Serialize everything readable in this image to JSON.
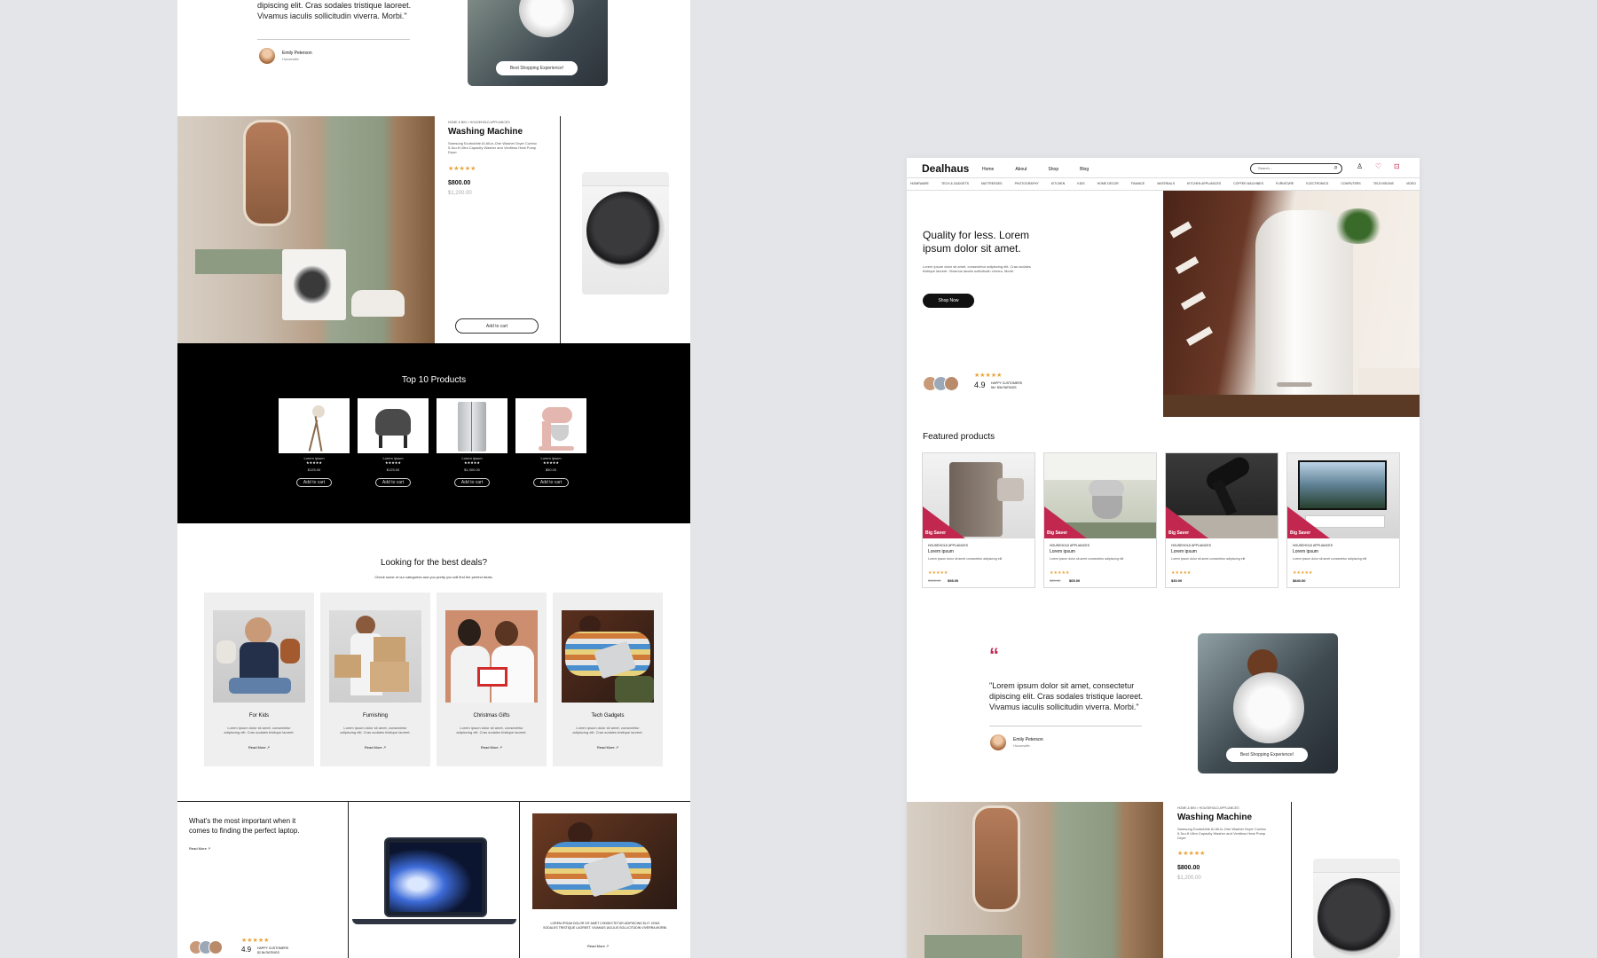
{
  "testimonial": {
    "quote": "\"Lorem ipsum dolor sit amet, consectetur dipiscing elit. Cras sodales tristique laoreet. Vivamus iaculis sollicitudin viverra. Morbi.\"",
    "quote_partial": "dipiscing elit. Cras sodales tristique laoreet. Vivamus iaculis sollicitudin viverra. Morbi.\"",
    "author": "Emily Peterson",
    "author_role": "Housewife",
    "cta": "Best Shopping Experience!"
  },
  "product_feature": {
    "breadcrumb": "HOME & BIN  >  HOUSEHOLD APPLIANCES",
    "title": "Washing Machine",
    "description": "Samsung Ecobubble AI All-in-One Washer Dryer Combo 5.3cu.ft Ultra Capacity Washer and Ventless Heat Pump Dryer",
    "price": "$800.00",
    "old_price": "$1,200.00",
    "add_to_cart": "Add to cart"
  },
  "top10": {
    "title": "Top 10 Products",
    "items": [
      {
        "name": "Lorem ipsum",
        "price": "$125.00",
        "btn": "Add to cart"
      },
      {
        "name": "Lorem ipsum",
        "price": "$125.00",
        "btn": "Add to cart"
      },
      {
        "name": "Lorem ipsum",
        "price": "$1,900.00",
        "btn": "Add to cart"
      },
      {
        "name": "Lorem ipsum",
        "price": "$50.00",
        "btn": "Add to cart"
      }
    ]
  },
  "deals": {
    "title": "Looking for the best deals?",
    "subtitle": "Check some of our categories and you pretty you will find the perfect deals.",
    "cards": [
      {
        "title": "For Kids",
        "desc": "Lorem ipsum dolor sit amet, consectetur adipiscing elit. Cras sodales tristique laoreet.",
        "link": "Read More"
      },
      {
        "title": "Furnishing",
        "desc": "Lorem ipsum dolor sit amet, consectetur adipiscing elit. Cras sodales tristique laoreet.",
        "link": "Read More"
      },
      {
        "title": "Christmas Gifts",
        "desc": "Lorem ipsum dolor sit amet, consectetur adipiscing elit. Cras sodales tristique laoreet.",
        "link": "Read More"
      },
      {
        "title": "Tech Gadgets",
        "desc": "Lorem ipsum dolor sit amet, consectetur adipiscing elit. Cras sodales tristique laoreet.",
        "link": "Read More"
      }
    ]
  },
  "laptop": {
    "title": "What's the most important when it comes to finding the perfect laptop.",
    "link": "Read More",
    "caption": "LOREM IPSUM DOLOR SIT AMET CONSECTETUR ADIPISCING ELIT. CRAS SODALES TRISTIQUE LAOREET. VIVAMUS IACULIS SOLLICITUDIN VIVERRA MORBI.",
    "rating": "4.9",
    "rating_label": "HAPPY CUSTOMERS",
    "rating_sub": "$2.5k RATINGS"
  },
  "header": {
    "logo": "Dealhaus",
    "nav": [
      "Home",
      "About",
      "Shop",
      "Blog"
    ],
    "search_placeholder": "Search...",
    "categories": [
      "HOMEWARE",
      "TECH & GADGETS",
      "MATTRESSES",
      "PHOTOGRAPHY",
      "KITCHEN",
      "KIDS",
      "HOME DECOR",
      "FINANCE",
      "MATERIALS",
      "KITCHEN APPLIANCES",
      "COFFEE MACHINES",
      "FURNITURE",
      "ELECTRONICS",
      "COMPUTERS",
      "TELEVISIONS",
      "VIDEO"
    ]
  },
  "hero": {
    "title": "Quality for less. Lorem ipsum dolor sit amet.",
    "desc": "Lorem ipsum dolor sit amet, consectetur adipiscing elit. Cras sodales tristique laoreet. Vivamus iaculis sollicitudin viverra. Morbi.",
    "cta": "Shop Now",
    "rating": "4.9",
    "rating_label": "HAPPY CUSTOMERS",
    "rating_sub": "5k+ 50k RATINGS"
  },
  "featured": {
    "title": "Featured products",
    "badge": "Big Saver",
    "items": [
      {
        "cat": "HOUSEHOLD APPLIANCES",
        "name": "Lorem ipsum",
        "desc": "Lorem ipsum dolor sit amet consectetur adipiscing elit",
        "old": "$125.00",
        "price": "$98.00"
      },
      {
        "cat": "HOUSEHOLD APPLIANCES",
        "name": "Lorem ipsum",
        "desc": "Lorem ipsum dolor sit amet consectetur adipiscing elit",
        "old": "$85.00",
        "price": "$65.00"
      },
      {
        "cat": "HOUSEHOLD APPLIANCES",
        "name": "Lorem ipsum",
        "desc": "Lorem ipsum dolor sit amet consectetur adipiscing elit",
        "old": "",
        "price": "$30.00"
      },
      {
        "cat": "HOUSEHOLD APPLIANCES",
        "name": "Lorem ipsum",
        "desc": "Lorem ipsum dolor sit amet consectetur adipiscing elit",
        "old": "",
        "price": "$840.00"
      }
    ]
  },
  "colors": {
    "accent": "#c2284f",
    "star": "#e8a43a",
    "dark": "#111111"
  }
}
